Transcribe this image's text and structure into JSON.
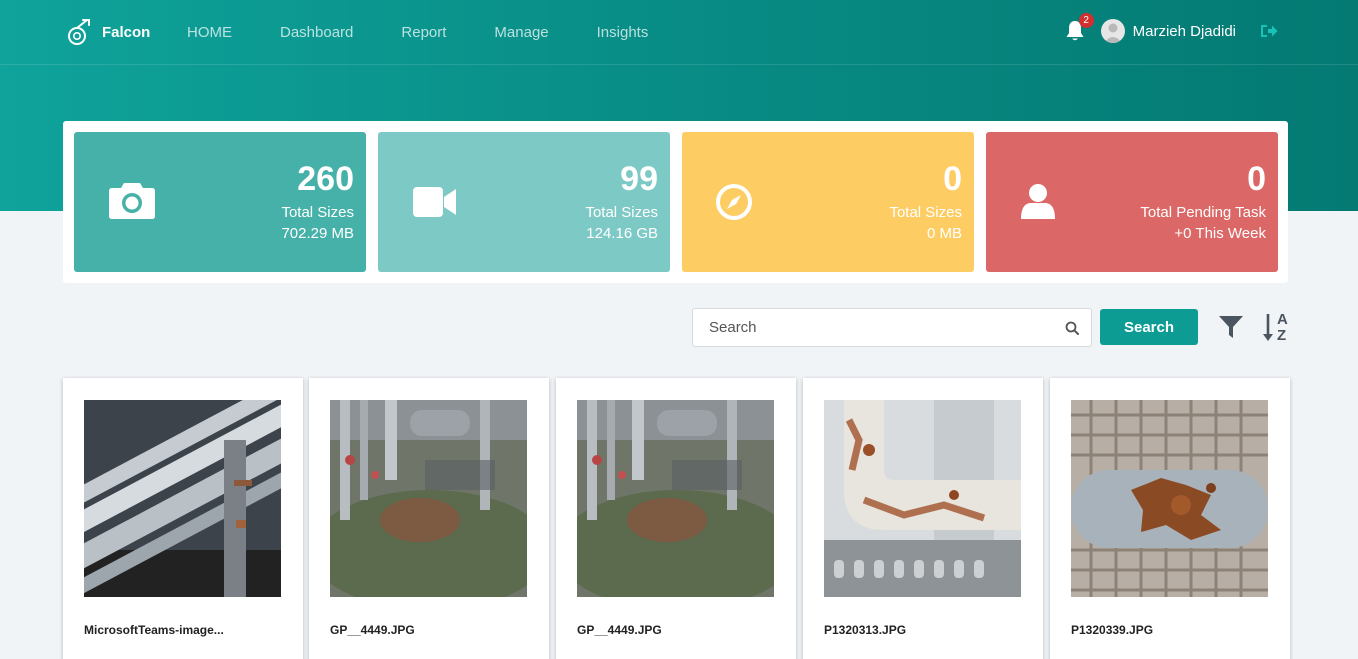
{
  "brand": {
    "name": "Falcon"
  },
  "nav": {
    "links": [
      "HOME",
      "Dashboard",
      "Report",
      "Manage",
      "Insights"
    ]
  },
  "user": {
    "name": "Marzieh Djadidi",
    "notifications": "2"
  },
  "stats": [
    {
      "value": "260",
      "label": "Total Sizes",
      "sub": "702.29 MB",
      "color": "#45b1a8",
      "icon": "camera-icon"
    },
    {
      "value": "99",
      "label": "Total Sizes",
      "sub": "124.16 GB",
      "color": "#7dc9c5",
      "icon": "video-camera-icon"
    },
    {
      "value": "0",
      "label": "Total Sizes",
      "sub": "0 MB",
      "color": "#fdcd64",
      "icon": "compass-icon"
    },
    {
      "value": "0",
      "label": "Total Pending Task",
      "sub": "+0 This Week",
      "color": "#dc6767",
      "icon": "user-icon"
    }
  ],
  "search": {
    "placeholder": "Search",
    "button": "Search"
  },
  "sort": {
    "top": "A",
    "bottom": "Z"
  },
  "colors": {
    "primary": "#0c9c94",
    "background": "#f1f4f7"
  },
  "gallery": [
    {
      "title": "MicrosoftTeams-image..."
    },
    {
      "title": "GP__4449.JPG"
    },
    {
      "title": "GP__4449.JPG"
    },
    {
      "title": "P1320313.JPG"
    },
    {
      "title": "P1320339.JPG"
    }
  ]
}
